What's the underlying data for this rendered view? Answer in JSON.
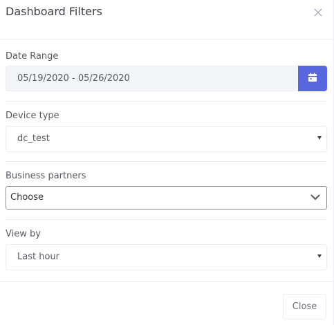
{
  "modal": {
    "title": "Dashboard Filters",
    "close_icon": "close-icon"
  },
  "date_range": {
    "label": "Date Range",
    "value": "05/19/2020 - 05/26/2020",
    "button_icon": "calendar-icon",
    "button_color": "#5867dd"
  },
  "device_type": {
    "label": "Device type",
    "selected": "dc_test"
  },
  "business_partners": {
    "label": "Business partners",
    "selected": "Choose"
  },
  "view_by": {
    "label": "View by",
    "selected": "Last hour"
  },
  "footer": {
    "close_label": "Close"
  }
}
